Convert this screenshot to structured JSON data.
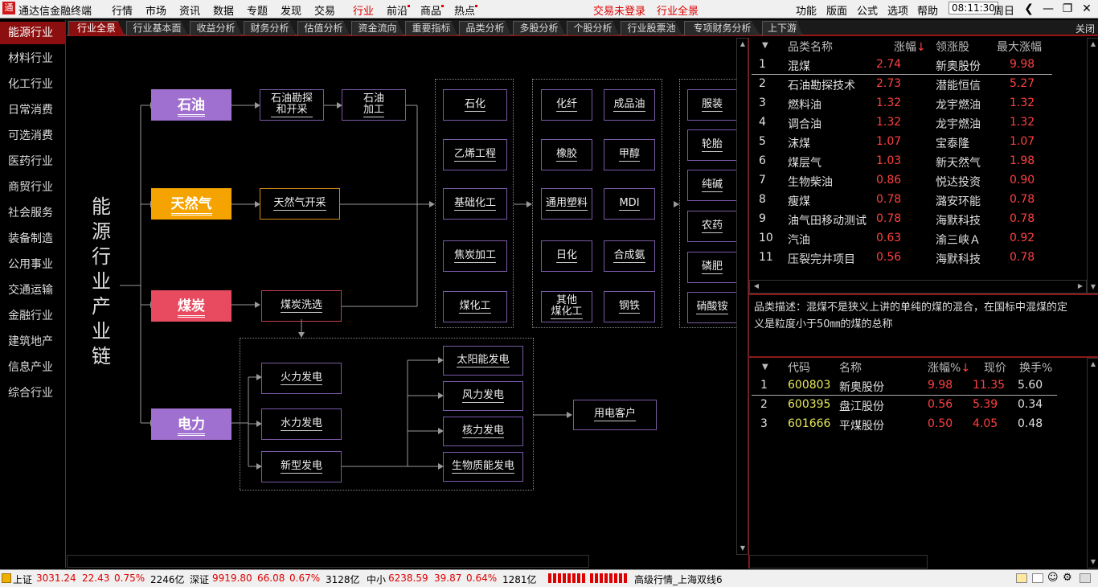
{
  "app": {
    "title": "通达信金融终端"
  },
  "menu": {
    "items": [
      "行情",
      "市场",
      "资讯",
      "数据",
      "专题",
      "发现",
      "交易",
      "行业",
      "前沿",
      "商品",
      "热点"
    ],
    "trade_status": "交易未登录",
    "industry_all": "行业全景",
    "right": [
      "功能",
      "版面",
      "公式",
      "选项",
      "帮助"
    ],
    "time": "08:11:30",
    "weekday": "周日"
  },
  "sidebar": {
    "items": [
      "能源行业",
      "材料行业",
      "化工行业",
      "日常消费",
      "可选消费",
      "医药行业",
      "商贸行业",
      "社会服务",
      "装备制造",
      "公用事业",
      "交通运输",
      "金融行业",
      "建筑地产",
      "信息产业",
      "综合行业"
    ]
  },
  "tabs": {
    "items": [
      "行业全景",
      "行业基本面",
      "收益分析",
      "财务分析",
      "估值分析",
      "资金流向",
      "重要指标",
      "品类分析",
      "多股分析",
      "个股分析",
      "行业股票池",
      "专项财务分析",
      "上下游"
    ],
    "close": "关闭"
  },
  "diagram": {
    "title_chars": [
      "能",
      "源",
      "行",
      "业",
      "产",
      "业",
      "链"
    ],
    "categories": {
      "oil": "石油",
      "gas": "天然气",
      "coal": "煤炭",
      "power": "电力"
    },
    "chain": {
      "oil_explore": "石油勘探\n和开采",
      "oil_process": "石油\n加工",
      "gas_explore": "天然气开采",
      "coal_wash": "煤炭洗选"
    },
    "col1": [
      "石化",
      "乙烯工程",
      "基础化工",
      "焦炭加工",
      "煤化工"
    ],
    "col2a": [
      "化纤",
      "橡胶",
      "通用塑料",
      "日化",
      "其他\n煤化工"
    ],
    "col2b": [
      "成品油",
      "甲醇",
      "MDI",
      "合成氨",
      "钢铁"
    ],
    "col3": [
      "服装",
      "轮胎",
      "纯碱",
      "农药",
      "磷肥",
      "硝酸铵"
    ],
    "power_types": [
      "火力发电",
      "水力发电",
      "新型发电"
    ],
    "new_energy": [
      "太阳能发电",
      "风力发电",
      "核力发电",
      "生物质能发电"
    ],
    "customer": "用电客户"
  },
  "table1": {
    "headers": [
      "品类名称",
      "涨幅",
      "领涨股",
      "最大涨幅"
    ],
    "rows": [
      {
        "no": "1",
        "name": "混煤",
        "pct": "2.74",
        "lead": "新奥股份",
        "max": "9.98"
      },
      {
        "no": "2",
        "name": "石油勘探技术",
        "pct": "2.73",
        "lead": "潜能恒信",
        "max": "5.27"
      },
      {
        "no": "3",
        "name": "燃料油",
        "pct": "1.32",
        "lead": "龙宇燃油",
        "max": "1.32"
      },
      {
        "no": "4",
        "name": "调合油",
        "pct": "1.32",
        "lead": "龙宇燃油",
        "max": "1.32"
      },
      {
        "no": "5",
        "name": "沫煤",
        "pct": "1.07",
        "lead": "宝泰隆",
        "max": "1.07"
      },
      {
        "no": "6",
        "name": "煤层气",
        "pct": "1.03",
        "lead": "新天然气",
        "max": "1.98"
      },
      {
        "no": "7",
        "name": "生物柴油",
        "pct": "0.86",
        "lead": "悦达投资",
        "max": "0.90"
      },
      {
        "no": "8",
        "name": "瘦煤",
        "pct": "0.78",
        "lead": "潞安环能",
        "max": "0.78"
      },
      {
        "no": "9",
        "name": "油气田移动测试",
        "pct": "0.78",
        "lead": "海默科技",
        "max": "0.78"
      },
      {
        "no": "10",
        "name": "汽油",
        "pct": "0.63",
        "lead": "渝三峡Ａ",
        "max": "0.92"
      },
      {
        "no": "11",
        "name": "压裂完井项目",
        "pct": "0.56",
        "lead": "海默科技",
        "max": "0.78"
      }
    ]
  },
  "description": {
    "line1": "品类描述：混煤不是狭义上讲的单纯的煤的混合，在国标中混煤的定",
    "line2": "义是粒度小于50㎜的煤的总称"
  },
  "table2": {
    "headers": [
      "代码",
      "名称",
      "涨幅%",
      "现价",
      "换手%"
    ],
    "rows": [
      {
        "no": "1",
        "code": "600803",
        "name": "新奥股份",
        "pct": "9.98",
        "price": "11.35",
        "turn": "5.60"
      },
      {
        "no": "2",
        "code": "600395",
        "name": "盘江股份",
        "pct": "0.56",
        "price": "5.39",
        "turn": "0.34"
      },
      {
        "no": "3",
        "code": "601666",
        "name": "平煤股份",
        "pct": "0.50",
        "price": "4.05",
        "turn": "0.48"
      }
    ]
  },
  "status": {
    "sh": {
      "name": "上证",
      "val": "3031.24",
      "chg": "22.43",
      "pct": "0.75%",
      "amt": "2246亿"
    },
    "sz": {
      "name": "深证",
      "val": "9919.80",
      "chg": "66.08",
      "pct": "0.67%",
      "amt": "3128亿"
    },
    "zx": {
      "name": "中小",
      "val": "6238.59",
      "chg": "39.87",
      "pct": "0.64%",
      "amt": "1281亿"
    },
    "line": "高级行情_上海双线6"
  },
  "colors": {
    "oil": "#a070d0",
    "gas": "#f5a300",
    "coal": "#e84a5f",
    "power": "#a070d0",
    "up": "#ff4040",
    "accent": "#8b0f0f"
  }
}
